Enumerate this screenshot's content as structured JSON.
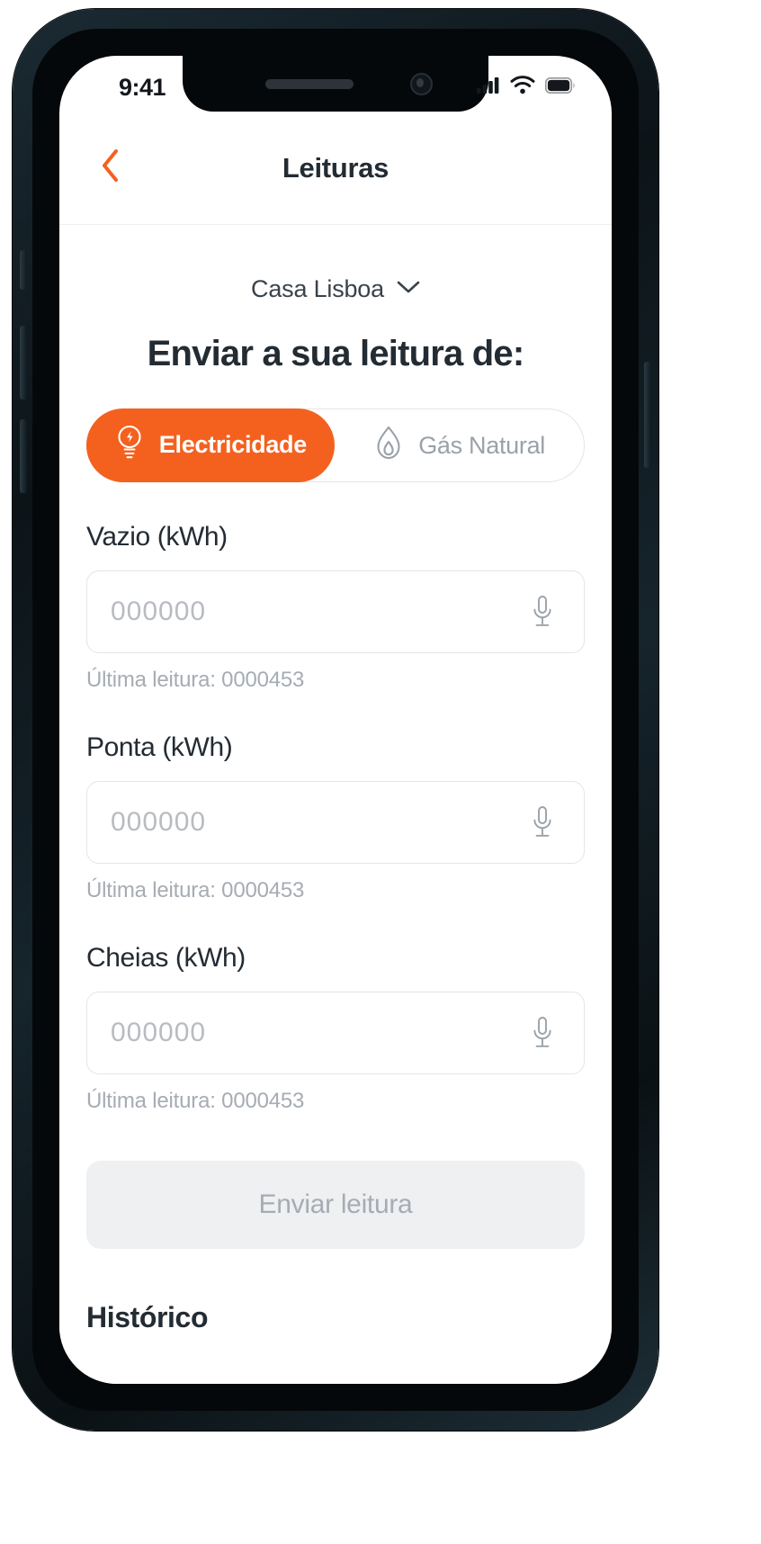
{
  "status_bar": {
    "time": "9:41",
    "icons": [
      "cellular-signal-icon",
      "wifi-icon",
      "battery-icon"
    ]
  },
  "nav": {
    "back_icon": "chevron-left-icon",
    "title": "Leituras"
  },
  "house_selector": {
    "name": "Casa Lisboa",
    "chevron_icon": "chevron-down-icon"
  },
  "heading": "Enviar a sua leitura de:",
  "energy_toggle": {
    "options": [
      {
        "label": "Electricidade",
        "icon": "lightbulb-icon",
        "active": true
      },
      {
        "label": "Gás Natural",
        "icon": "flame-icon",
        "active": false
      }
    ]
  },
  "readings": [
    {
      "label": "Vazio (kWh)",
      "value": "",
      "placeholder": "000000",
      "hint": "Última leitura: 0000453",
      "mic_icon": "microphone-icon"
    },
    {
      "label": "Ponta (kWh)",
      "value": "",
      "placeholder": "000000",
      "hint": "Última leitura: 0000453",
      "mic_icon": "microphone-icon"
    },
    {
      "label": "Cheias (kWh)",
      "value": "",
      "placeholder": "000000",
      "hint": "Última leitura: 0000453",
      "mic_icon": "microphone-icon"
    }
  ],
  "submit": {
    "label": "Enviar leitura",
    "enabled": false
  },
  "history": {
    "title": "Histórico"
  },
  "colors": {
    "accent": "#f4611f",
    "text_primary": "#232b33",
    "text_muted": "#a6acb3",
    "border": "#e2e5e8",
    "disabled_bg": "#eff0f2"
  }
}
